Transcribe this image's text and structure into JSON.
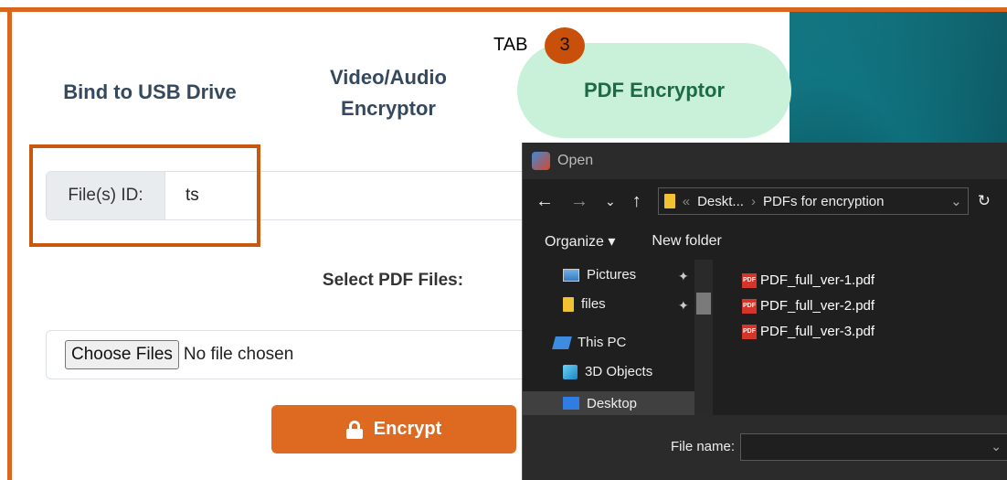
{
  "annotation": {
    "tab_label": "TAB",
    "step_number": "3"
  },
  "tabs": [
    {
      "label": "Bind to USB Drive"
    },
    {
      "label": "Video/Audio\nEncryptor"
    },
    {
      "label": "PDF Encryptor",
      "active": true
    }
  ],
  "file_id": {
    "label": "File(s) ID:",
    "value": "ts"
  },
  "select_files": {
    "label": "Select PDF Files:",
    "button_label": "Choose Files",
    "status": "No file chosen"
  },
  "encrypt_button": {
    "label": "Encrypt",
    "icon": "lock-icon"
  },
  "dialog": {
    "title": "Open",
    "breadcrumb": {
      "overflow": "«",
      "part1": "Deskt...",
      "separator": "›",
      "part2": "PDFs for encryption"
    },
    "toolbar": {
      "organize": "Organize ▾",
      "new_folder": "New folder"
    },
    "nav_items": [
      {
        "label": "Pictures",
        "icon": "pictures-icon",
        "pinned": true
      },
      {
        "label": "files",
        "icon": "folder-icon",
        "pinned": true
      },
      {
        "label": "This PC",
        "icon": "computer-icon"
      },
      {
        "label": "3D Objects",
        "icon": "3d-objects-icon"
      },
      {
        "label": "Desktop",
        "icon": "desktop-icon",
        "selected": true
      }
    ],
    "files": [
      {
        "name": "PDF_full_ver-1.pdf"
      },
      {
        "name": "PDF_full_ver-2.pdf"
      },
      {
        "name": "PDF_full_ver-3.pdf"
      }
    ],
    "file_name_label": "File name:",
    "file_name_value": ""
  },
  "colors": {
    "accent": "#de6a22",
    "active_tab_bg": "#c9f0d8",
    "active_tab_text": "#1d6b46",
    "highlight": "#c9580f"
  }
}
